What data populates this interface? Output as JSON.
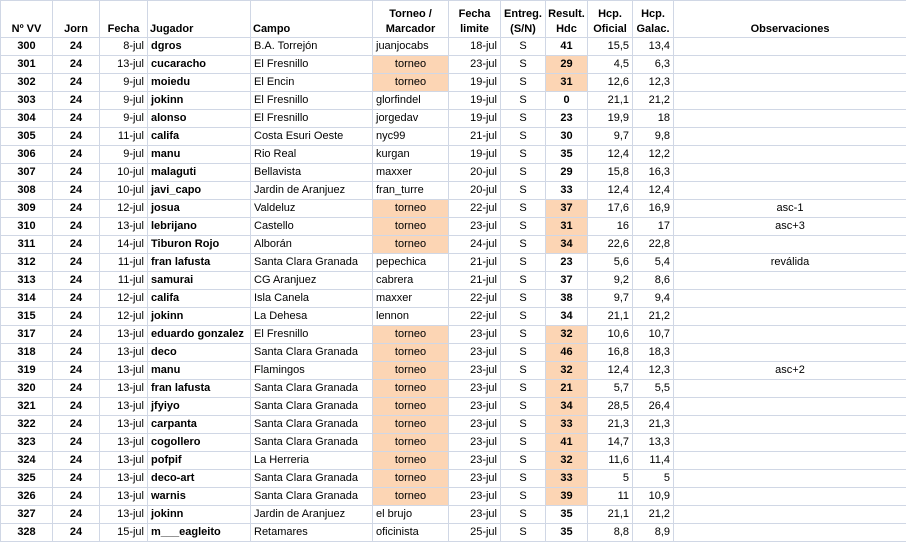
{
  "header": {
    "nvv": "Nº VV",
    "jorn": "Jorn",
    "fecha": "Fecha",
    "jugador": "Jugador",
    "campo": "Campo",
    "torneo_l1": "Torneo /",
    "torneo_l2": "Marcador",
    "limite_l1": "Fecha",
    "limite_l2": "limite",
    "entreg_l1": "Entreg.",
    "entreg_l2": "(S/N)",
    "result_l1": "Result.",
    "result_l2": "Hdc",
    "hcpo_l1": "Hcp.",
    "hcpo_l2": "Oficial",
    "hcpg_l1": "Hcp.",
    "hcpg_l2": "Galac.",
    "obs": "Observaciones"
  },
  "colors": {
    "highlight": "#fcd5b4",
    "grid": "#d0d7e5"
  },
  "rows": [
    {
      "nvv": "300",
      "jorn": "24",
      "fecha": "8-jul",
      "jugador": "dgros",
      "campo": "B.A. Torrejón",
      "torneo": "juanjocabs",
      "torneo_hl": false,
      "limite": "18-jul",
      "entreg": "S",
      "result": "41",
      "result_hl": false,
      "hcpo": "15,5",
      "hcpg": "13,4",
      "obs": ""
    },
    {
      "nvv": "301",
      "jorn": "24",
      "fecha": "13-jul",
      "jugador": "cucaracho",
      "campo": "El Fresnillo",
      "torneo": "torneo",
      "torneo_hl": true,
      "limite": "23-jul",
      "entreg": "S",
      "result": "29",
      "result_hl": true,
      "hcpo": "4,5",
      "hcpg": "6,3",
      "obs": ""
    },
    {
      "nvv": "302",
      "jorn": "24",
      "fecha": "9-jul",
      "jugador": "moiedu",
      "campo": "El Encin",
      "torneo": "torneo",
      "torneo_hl": true,
      "limite": "19-jul",
      "entreg": "S",
      "result": "31",
      "result_hl": true,
      "hcpo": "12,6",
      "hcpg": "12,3",
      "obs": ""
    },
    {
      "nvv": "303",
      "jorn": "24",
      "fecha": "9-jul",
      "jugador": "jokinn",
      "campo": "El Fresnillo",
      "torneo": "glorfindel",
      "torneo_hl": false,
      "limite": "19-jul",
      "entreg": "S",
      "result": "0",
      "result_hl": false,
      "hcpo": "21,1",
      "hcpg": "21,2",
      "obs": ""
    },
    {
      "nvv": "304",
      "jorn": "24",
      "fecha": "9-jul",
      "jugador": "alonso",
      "campo": "El Fresnillo",
      "torneo": "jorgedav",
      "torneo_hl": false,
      "limite": "19-jul",
      "entreg": "S",
      "result": "23",
      "result_hl": false,
      "hcpo": "19,9",
      "hcpg": "18",
      "obs": ""
    },
    {
      "nvv": "305",
      "jorn": "24",
      "fecha": "11-jul",
      "jugador": "califa",
      "campo": "Costa Esuri Oeste",
      "torneo": "nyc99",
      "torneo_hl": false,
      "limite": "21-jul",
      "entreg": "S",
      "result": "30",
      "result_hl": false,
      "hcpo": "9,7",
      "hcpg": "9,8",
      "obs": ""
    },
    {
      "nvv": "306",
      "jorn": "24",
      "fecha": "9-jul",
      "jugador": "manu",
      "campo": "Rio Real",
      "torneo": "kurgan",
      "torneo_hl": false,
      "limite": "19-jul",
      "entreg": "S",
      "result": "35",
      "result_hl": false,
      "hcpo": "12,4",
      "hcpg": "12,2",
      "obs": ""
    },
    {
      "nvv": "307",
      "jorn": "24",
      "fecha": "10-jul",
      "jugador": "malaguti",
      "campo": "Bellavista",
      "torneo": "maxxer",
      "torneo_hl": false,
      "limite": "20-jul",
      "entreg": "S",
      "result": "29",
      "result_hl": false,
      "hcpo": "15,8",
      "hcpg": "16,3",
      "obs": ""
    },
    {
      "nvv": "308",
      "jorn": "24",
      "fecha": "10-jul",
      "jugador": "javi_capo",
      "campo": "Jardin de Aranjuez",
      "torneo": "fran_turre",
      "torneo_hl": false,
      "limite": "20-jul",
      "entreg": "S",
      "result": "33",
      "result_hl": false,
      "hcpo": "12,4",
      "hcpg": "12,4",
      "obs": ""
    },
    {
      "nvv": "309",
      "jorn": "24",
      "fecha": "12-jul",
      "jugador": "josua",
      "campo": "Valdeluz",
      "torneo": "torneo",
      "torneo_hl": true,
      "limite": "22-jul",
      "entreg": "S",
      "result": "37",
      "result_hl": true,
      "hcpo": "17,6",
      "hcpg": "16,9",
      "obs": "asc-1"
    },
    {
      "nvv": "310",
      "jorn": "24",
      "fecha": "13-jul",
      "jugador": "lebrijano",
      "campo": "Castello",
      "torneo": "torneo",
      "torneo_hl": true,
      "limite": "23-jul",
      "entreg": "S",
      "result": "31",
      "result_hl": true,
      "hcpo": "16",
      "hcpg": "17",
      "obs": "asc+3"
    },
    {
      "nvv": "311",
      "jorn": "24",
      "fecha": "14-jul",
      "jugador": "Tiburon Rojo",
      "campo": "Alborán",
      "torneo": "torneo",
      "torneo_hl": true,
      "limite": "24-jul",
      "entreg": "S",
      "result": "34",
      "result_hl": true,
      "hcpo": "22,6",
      "hcpg": "22,8",
      "obs": ""
    },
    {
      "nvv": "312",
      "jorn": "24",
      "fecha": "11-jul",
      "jugador": "fran lafusta",
      "campo": "Santa Clara Granada",
      "torneo": "pepechica",
      "torneo_hl": false,
      "limite": "21-jul",
      "entreg": "S",
      "result": "23",
      "result_hl": false,
      "hcpo": "5,6",
      "hcpg": "5,4",
      "obs": "reválida"
    },
    {
      "nvv": "313",
      "jorn": "24",
      "fecha": "11-jul",
      "jugador": "samurai",
      "campo": "CG Aranjuez",
      "torneo": "cabrera",
      "torneo_hl": false,
      "limite": "21-jul",
      "entreg": "S",
      "result": "37",
      "result_hl": false,
      "hcpo": "9,2",
      "hcpg": "8,6",
      "obs": ""
    },
    {
      "nvv": "314",
      "jorn": "24",
      "fecha": "12-jul",
      "jugador": "califa",
      "campo": "Isla Canela",
      "torneo": "maxxer",
      "torneo_hl": false,
      "limite": "22-jul",
      "entreg": "S",
      "result": "38",
      "result_hl": false,
      "hcpo": "9,7",
      "hcpg": "9,4",
      "obs": ""
    },
    {
      "nvv": "315",
      "jorn": "24",
      "fecha": "12-jul",
      "jugador": "jokinn",
      "campo": "La Dehesa",
      "torneo": "lennon",
      "torneo_hl": false,
      "limite": "22-jul",
      "entreg": "S",
      "result": "34",
      "result_hl": false,
      "hcpo": "21,1",
      "hcpg": "21,2",
      "obs": ""
    },
    {
      "nvv": "317",
      "jorn": "24",
      "fecha": "13-jul",
      "jugador": "eduardo gonzalez",
      "campo": "El Fresnillo",
      "torneo": "torneo",
      "torneo_hl": true,
      "limite": "23-jul",
      "entreg": "S",
      "result": "32",
      "result_hl": true,
      "hcpo": "10,6",
      "hcpg": "10,7",
      "obs": ""
    },
    {
      "nvv": "318",
      "jorn": "24",
      "fecha": "13-jul",
      "jugador": "deco",
      "campo": "Santa Clara Granada",
      "torneo": "torneo",
      "torneo_hl": true,
      "limite": "23-jul",
      "entreg": "S",
      "result": "46",
      "result_hl": true,
      "hcpo": "16,8",
      "hcpg": "18,3",
      "obs": ""
    },
    {
      "nvv": "319",
      "jorn": "24",
      "fecha": "13-jul",
      "jugador": "manu",
      "campo": "Flamingos",
      "torneo": "torneo",
      "torneo_hl": true,
      "limite": "23-jul",
      "entreg": "S",
      "result": "32",
      "result_hl": true,
      "hcpo": "12,4",
      "hcpg": "12,3",
      "obs": "asc+2"
    },
    {
      "nvv": "320",
      "jorn": "24",
      "fecha": "13-jul",
      "jugador": "fran lafusta",
      "campo": "Santa Clara Granada",
      "torneo": "torneo",
      "torneo_hl": true,
      "limite": "23-jul",
      "entreg": "S",
      "result": "21",
      "result_hl": true,
      "hcpo": "5,7",
      "hcpg": "5,5",
      "obs": ""
    },
    {
      "nvv": "321",
      "jorn": "24",
      "fecha": "13-jul",
      "jugador": "jfyiyo",
      "campo": "Santa Clara Granada",
      "torneo": "torneo",
      "torneo_hl": true,
      "limite": "23-jul",
      "entreg": "S",
      "result": "34",
      "result_hl": true,
      "hcpo": "28,5",
      "hcpg": "26,4",
      "obs": ""
    },
    {
      "nvv": "322",
      "jorn": "24",
      "fecha": "13-jul",
      "jugador": "carpanta",
      "campo": "Santa Clara Granada",
      "torneo": "torneo",
      "torneo_hl": true,
      "limite": "23-jul",
      "entreg": "S",
      "result": "33",
      "result_hl": true,
      "hcpo": "21,3",
      "hcpg": "21,3",
      "obs": ""
    },
    {
      "nvv": "323",
      "jorn": "24",
      "fecha": "13-jul",
      "jugador": "cogollero",
      "campo": "Santa Clara Granada",
      "torneo": "torneo",
      "torneo_hl": true,
      "limite": "23-jul",
      "entreg": "S",
      "result": "41",
      "result_hl": true,
      "hcpo": "14,7",
      "hcpg": "13,3",
      "obs": ""
    },
    {
      "nvv": "324",
      "jorn": "24",
      "fecha": "13-jul",
      "jugador": "pofpif",
      "campo": "La Herreria",
      "torneo": "torneo",
      "torneo_hl": true,
      "limite": "23-jul",
      "entreg": "S",
      "result": "32",
      "result_hl": true,
      "hcpo": "11,6",
      "hcpg": "11,4",
      "obs": ""
    },
    {
      "nvv": "325",
      "jorn": "24",
      "fecha": "13-jul",
      "jugador": "deco-art",
      "campo": "Santa Clara Granada",
      "torneo": "torneo",
      "torneo_hl": true,
      "limite": "23-jul",
      "entreg": "S",
      "result": "33",
      "result_hl": true,
      "hcpo": "5",
      "hcpg": "5",
      "obs": ""
    },
    {
      "nvv": "326",
      "jorn": "24",
      "fecha": "13-jul",
      "jugador": "warnis",
      "campo": "Santa Clara Granada",
      "torneo": "torneo",
      "torneo_hl": true,
      "limite": "23-jul",
      "entreg": "S",
      "result": "39",
      "result_hl": true,
      "hcpo": "11",
      "hcpg": "10,9",
      "obs": ""
    },
    {
      "nvv": "327",
      "jorn": "24",
      "fecha": "13-jul",
      "jugador": "jokinn",
      "campo": "Jardin de Aranjuez",
      "torneo": "el brujo",
      "torneo_hl": false,
      "limite": "23-jul",
      "entreg": "S",
      "result": "35",
      "result_hl": false,
      "hcpo": "21,1",
      "hcpg": "21,2",
      "obs": ""
    },
    {
      "nvv": "328",
      "jorn": "24",
      "fecha": "15-jul",
      "jugador": "m___eagleito",
      "campo": "Retamares",
      "torneo": "oficinista",
      "torneo_hl": false,
      "limite": "25-jul",
      "entreg": "S",
      "result": "35",
      "result_hl": false,
      "hcpo": "8,8",
      "hcpg": "8,9",
      "obs": ""
    }
  ]
}
